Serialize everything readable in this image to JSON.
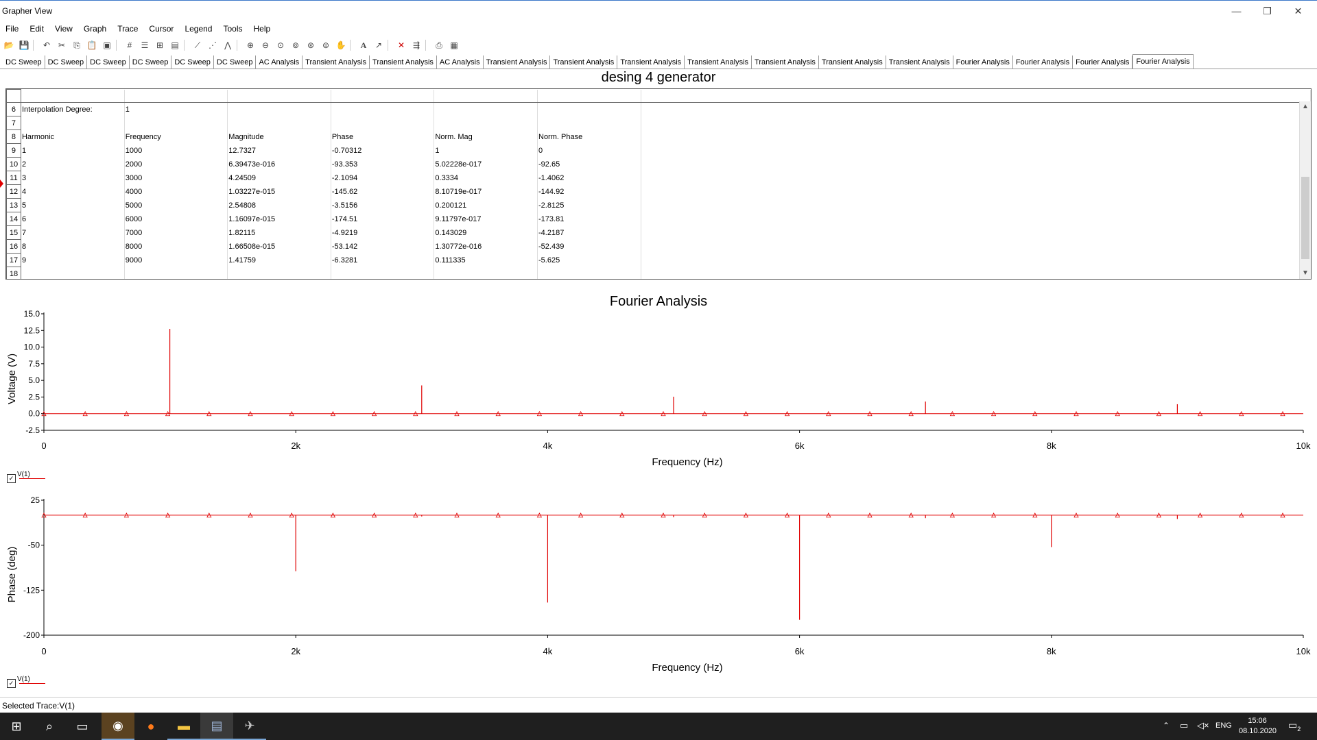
{
  "window": {
    "title": "Grapher View",
    "controls": [
      "—",
      "❐",
      "✕"
    ]
  },
  "menu": [
    "File",
    "Edit",
    "View",
    "Graph",
    "Trace",
    "Cursor",
    "Legend",
    "Tools",
    "Help"
  ],
  "tabs": [
    "DC Sweep",
    "DC Sweep",
    "DC Sweep",
    "DC Sweep",
    "DC Sweep",
    "DC Sweep",
    "AC Analysis",
    "Transient Analysis",
    "Transient Analysis",
    "AC Analysis",
    "Transient Analysis",
    "Transient Analysis",
    "Transient Analysis",
    "Transient Analysis",
    "Transient Analysis",
    "Transient Analysis",
    "Transient Analysis",
    "Fourier Analysis",
    "Fourier Analysis",
    "Fourier Analysis",
    "Fourier Analysis"
  ],
  "active_tab_index": 20,
  "table": {
    "title": "desing 4 generator",
    "interp_label": "Interpolation Degree:",
    "interp_value": "1",
    "columns": [
      "Harmonic",
      "Frequency",
      "Magnitude",
      "Phase",
      "Norm. Mag",
      "Norm. Phase"
    ],
    "rows": [
      [
        "1",
        "1000",
        "12.7327",
        "-0.70312",
        "1",
        "0"
      ],
      [
        "2",
        "2000",
        "6.39473e-016",
        "-93.353",
        "5.02228e-017",
        "-92.65"
      ],
      [
        "3",
        "3000",
        "4.24509",
        "-2.1094",
        "0.3334",
        "-1.4062"
      ],
      [
        "4",
        "4000",
        "1.03227e-015",
        "-145.62",
        "8.10719e-017",
        "-144.92"
      ],
      [
        "5",
        "5000",
        "2.54808",
        "-3.5156",
        "0.200121",
        "-2.8125"
      ],
      [
        "6",
        "6000",
        "1.16097e-015",
        "-174.51",
        "9.11797e-017",
        "-173.81"
      ],
      [
        "7",
        "7000",
        "1.82115",
        "-4.9219",
        "0.143029",
        "-4.2187"
      ],
      [
        "8",
        "8000",
        "1.66508e-015",
        "-53.142",
        "1.30772e-016",
        "-52.439"
      ],
      [
        "9",
        "9000",
        "1.41759",
        "-6.3281",
        "0.111335",
        "-5.625"
      ]
    ],
    "row_numbers": [
      "6",
      "7",
      "8",
      "9",
      "10",
      "11",
      "12",
      "13",
      "14",
      "15",
      "16",
      "17",
      "18"
    ]
  },
  "chart_data": [
    {
      "type": "line",
      "title": "Fourier Analysis",
      "xlabel": "Frequency (Hz)",
      "ylabel": "Voltage (V)",
      "xlim": [
        0,
        10000
      ],
      "ylim": [
        -2.5,
        15.0
      ],
      "x_ticks": [
        "0",
        "2k",
        "4k",
        "6k",
        "8k",
        "10k"
      ],
      "y_ticks": [
        "15.0",
        "12.5",
        "10.0",
        "7.5",
        "5.0",
        "2.5",
        "0.0",
        "-2.5"
      ],
      "y_tick_values": [
        15.0,
        12.5,
        10.0,
        7.5,
        5.0,
        2.5,
        0.0,
        -2.5
      ],
      "series": [
        {
          "name": "V(1)",
          "color": "#e00000",
          "x": [
            1000,
            2000,
            3000,
            4000,
            5000,
            6000,
            7000,
            8000,
            9000
          ],
          "y": [
            12.7327,
            0,
            4.24509,
            0,
            2.54808,
            0,
            1.82115,
            0,
            1.41759
          ]
        }
      ]
    },
    {
      "type": "line",
      "xlabel": "Frequency (Hz)",
      "ylabel": "Phase (deg)",
      "xlim": [
        0,
        10000
      ],
      "ylim": [
        -200,
        25
      ],
      "x_ticks": [
        "0",
        "2k",
        "4k",
        "6k",
        "8k",
        "10k"
      ],
      "y_ticks": [
        "25",
        "-50",
        "-125",
        "-200"
      ],
      "y_tick_values": [
        25,
        -50,
        -125,
        -200
      ],
      "series": [
        {
          "name": "V(1)",
          "color": "#e00000",
          "x": [
            1000,
            2000,
            3000,
            4000,
            5000,
            6000,
            7000,
            8000,
            9000
          ],
          "y": [
            -0.70312,
            -93.353,
            -2.1094,
            -145.62,
            -3.5156,
            -174.51,
            -4.9219,
            -53.142,
            -6.3281
          ]
        }
      ]
    }
  ],
  "legend_label": "V(1)",
  "status": "Selected Trace:V(1)",
  "tray": {
    "lang": "ENG",
    "time": "15:06",
    "date": "08.10.2020",
    "notif": "2"
  }
}
